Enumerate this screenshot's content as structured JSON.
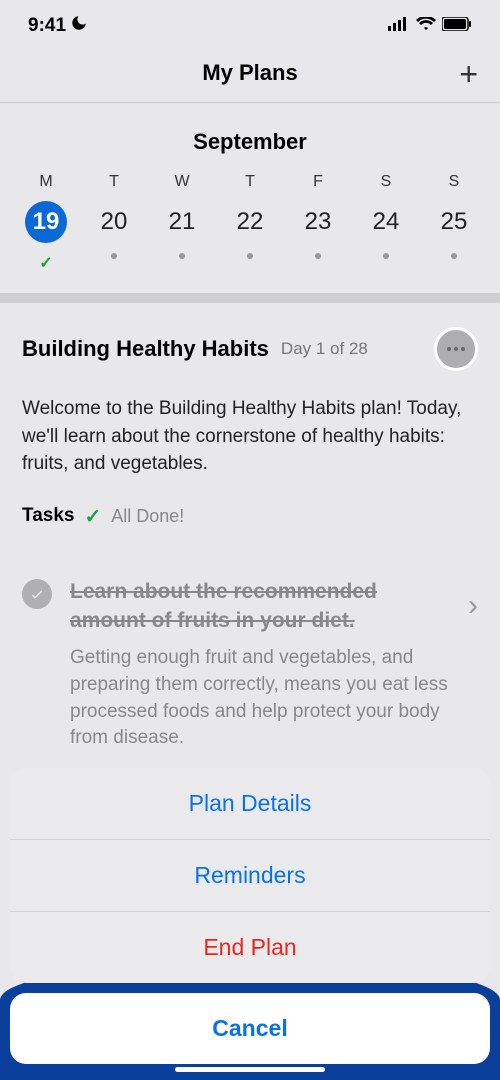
{
  "status": {
    "time": "9:41"
  },
  "header": {
    "title": "My Plans"
  },
  "calendar": {
    "month": "September",
    "days": [
      {
        "letter": "M",
        "num": "19",
        "selected": true,
        "checked": true
      },
      {
        "letter": "T",
        "num": "20"
      },
      {
        "letter": "W",
        "num": "21"
      },
      {
        "letter": "T",
        "num": "22"
      },
      {
        "letter": "F",
        "num": "23"
      },
      {
        "letter": "S",
        "num": "24"
      },
      {
        "letter": "S",
        "num": "25"
      }
    ]
  },
  "plan": {
    "title": "Building Healthy Habits",
    "day": "Day 1 of 28",
    "description": "Welcome to the Building Healthy Habits plan! Today, we'll learn about the cornerstone of healthy habits: fruits, and vegetables.",
    "tasks_label": "Tasks",
    "tasks_status": "All Done!",
    "task": {
      "title": "Learn about the recommended amount of fruits in your diet.",
      "desc": "Getting enough fruit and vegetables, and preparing them correctly, means you eat less processed foods and help protect your body from disease."
    }
  },
  "sheet": {
    "details": "Plan Details",
    "reminders": "Reminders",
    "end": "End Plan",
    "cancel": "Cancel"
  }
}
